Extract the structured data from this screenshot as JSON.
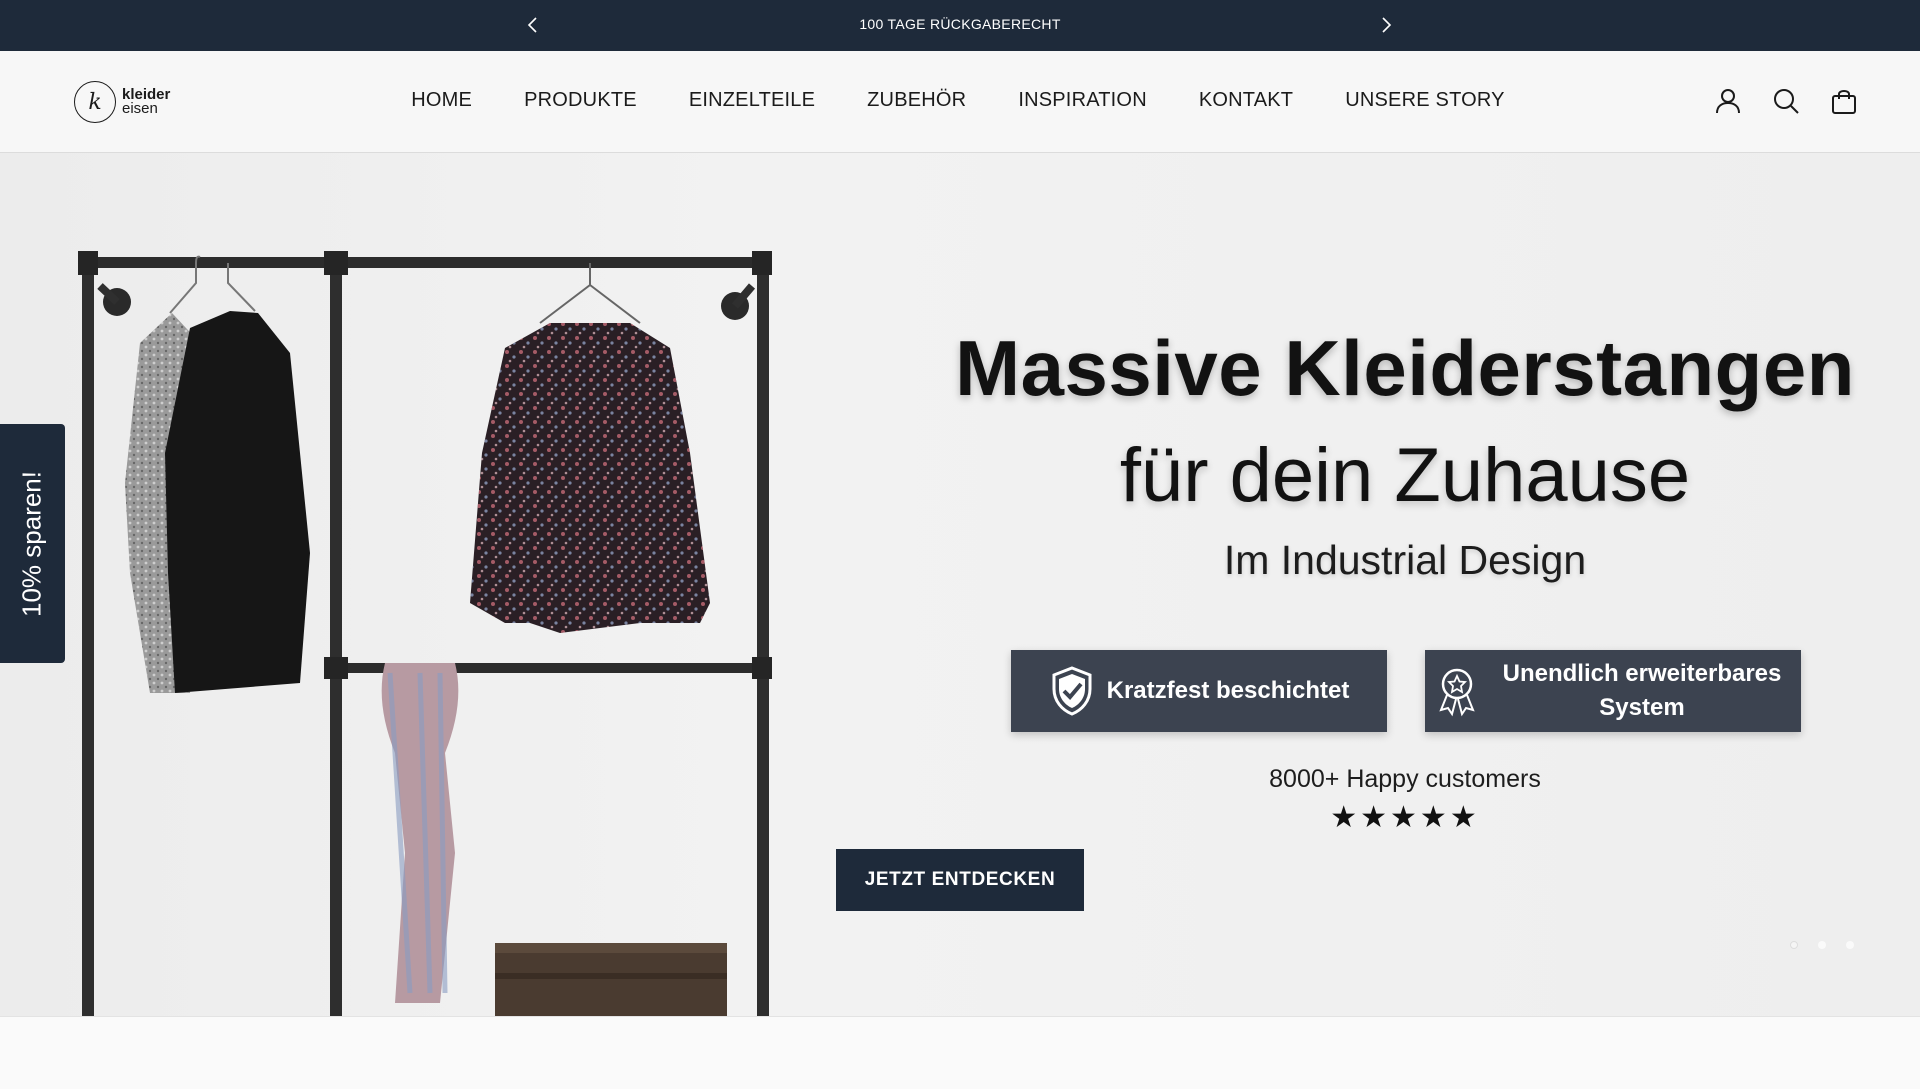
{
  "announcement": {
    "message": "100 TAGE RÜCKGABERECHT",
    "prev_icon": "chevron-left-icon",
    "next_icon": "chevron-right-icon"
  },
  "header": {
    "logo": {
      "mark": "k",
      "line1": "kleider",
      "line2": "eisen"
    },
    "nav": [
      "HOME",
      "PRODUKTE",
      "EINZELTEILE",
      "ZUBEHÖR",
      "INSPIRATION",
      "KONTAKT",
      "UNSERE STORY"
    ],
    "icons": [
      "account-icon",
      "search-icon",
      "cart-bag-icon"
    ]
  },
  "hero": {
    "headline_1": "Massive  Kleiderstangen",
    "headline_2": "für dein Zuhause",
    "headline_3": "Im Industrial Design",
    "badge_1": "Kratzfest beschichtet",
    "badge_2": "Unendlich erweiterbares System",
    "social_proof": "8000+ Happy customers",
    "stars": "★★★★★",
    "rating": 5,
    "cta": "JETZT ENTDECKEN",
    "slides": 3,
    "active_slide": 1
  },
  "side_tab": {
    "label": "10% sparen!"
  },
  "colors": {
    "navy": "#1e2a3a",
    "badge": "#3c4350",
    "text": "#121212"
  }
}
